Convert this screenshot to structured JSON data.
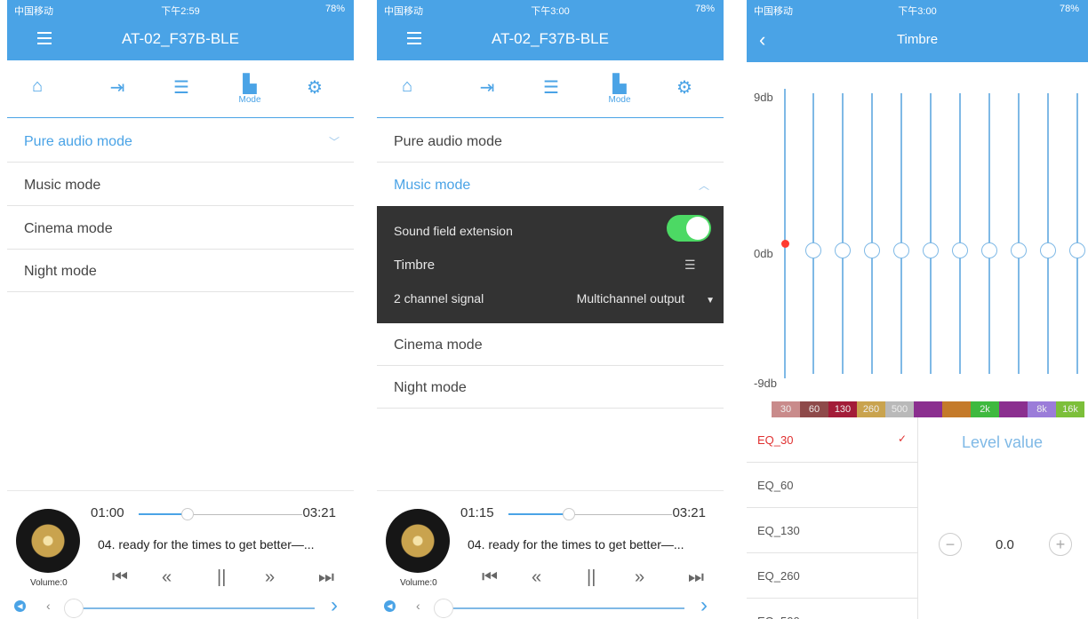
{
  "status_bar": {
    "carrier": "中国移动",
    "battery": "78%",
    "times": [
      "下午2:59",
      "下午3:00",
      "下午3:00"
    ]
  },
  "device_title": "AT-02_F37B-BLE",
  "tabs": {
    "mode_caption": "Mode"
  },
  "modes": [
    "Pure audio mode",
    "Music mode",
    "Cinema mode",
    "Night mode"
  ],
  "music_settings": {
    "sound_field_extension": "Sound field extension",
    "sound_field_enabled": true,
    "timbre": "Timbre",
    "channel_signal": "2 channel signal",
    "channel_output": "Multichannel output"
  },
  "player1": {
    "current_time": "01:00",
    "total_time": "03:21",
    "progress": 0.3,
    "song": "04.  ready for the times to get better—...",
    "volume_label": "Volume:0"
  },
  "player2": {
    "current_time": "01:15",
    "total_time": "03:21",
    "progress": 0.37,
    "song": "04.  ready for the times to get better—...",
    "volume_label": "Volume:0"
  },
  "eq": {
    "title": "Timbre",
    "db_top": "9db",
    "db_mid": "0db",
    "db_bottom": "-9db",
    "freq_bands": [
      "30",
      "60",
      "130",
      "260",
      "500",
      "",
      "",
      "2k",
      "",
      "8k",
      "16k"
    ],
    "band_colors": [
      "#c98b8b",
      "#8e4a4a",
      "#a31c38",
      "#c9a34e",
      "#b9b9b9",
      "#8b2f8f",
      "#c47a2a",
      "#3fb93f",
      "#8b2f8f",
      "#9b7cd9",
      "#7cbf3a"
    ],
    "list": [
      "EQ_30",
      "EQ_60",
      "EQ_130",
      "EQ_260",
      "EQ_500"
    ],
    "selected": "EQ_30",
    "level_title": "Level value",
    "level_value": "0.0"
  }
}
